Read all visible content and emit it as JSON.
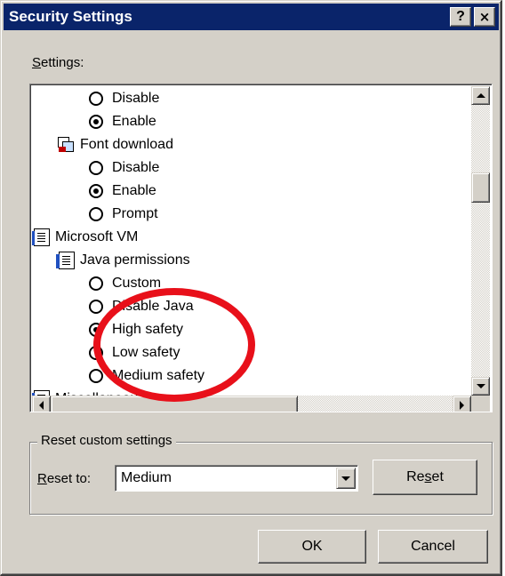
{
  "window": {
    "title": "Security Settings",
    "help_button": "?",
    "close_button": "×"
  },
  "settings": {
    "label": "Settings:",
    "tree": [
      {
        "kind": "radio",
        "label": "Disable",
        "checked": false
      },
      {
        "kind": "radio",
        "label": "Enable",
        "checked": true
      },
      {
        "kind": "category",
        "icon": "font-download-icon",
        "label": "Font download"
      },
      {
        "kind": "radio",
        "label": "Disable",
        "checked": false
      },
      {
        "kind": "radio",
        "label": "Enable",
        "checked": true
      },
      {
        "kind": "radio",
        "label": "Prompt",
        "checked": false
      },
      {
        "kind": "category",
        "icon": "document-icon",
        "label": "Microsoft VM"
      },
      {
        "kind": "category",
        "icon": "document-icon",
        "label": "Java permissions"
      },
      {
        "kind": "radio",
        "label": "Custom",
        "checked": false
      },
      {
        "kind": "radio",
        "label": "Disable Java",
        "checked": false
      },
      {
        "kind": "radio",
        "label": "High safety",
        "checked": true
      },
      {
        "kind": "radio",
        "label": "Low safety",
        "checked": false
      },
      {
        "kind": "radio",
        "label": "Medium safety",
        "checked": false
      },
      {
        "kind": "category",
        "icon": "document-icon",
        "label": "Miscellaneous"
      }
    ]
  },
  "reset": {
    "group_label": "Reset custom settings",
    "reset_to_label": "Reset to:",
    "selected": "Medium",
    "reset_button": "Reset"
  },
  "footer": {
    "ok_label": "OK",
    "cancel_label": "Cancel"
  },
  "colors": {
    "titlebar": "#0a246a",
    "highlight": "#e8101a"
  }
}
